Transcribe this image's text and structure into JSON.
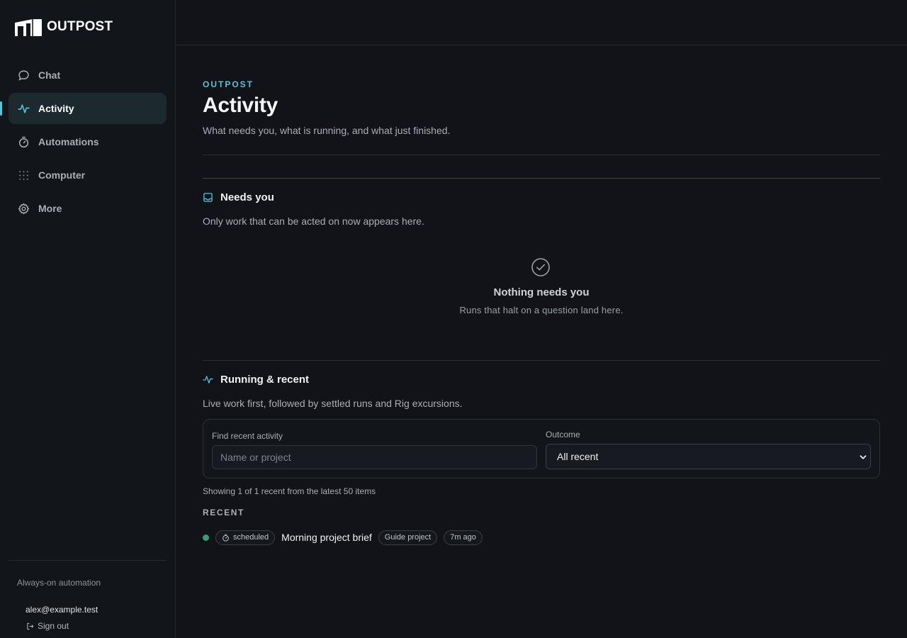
{
  "brand": {
    "name": "OUTPOST"
  },
  "sidebar": {
    "items": [
      {
        "label": "Chat",
        "icon": "chat-bubble-icon",
        "active": false
      },
      {
        "label": "Activity",
        "icon": "pulse-icon",
        "active": true
      },
      {
        "label": "Automations",
        "icon": "stopwatch-icon",
        "active": false
      },
      {
        "label": "Computer",
        "icon": "grid-dots-icon",
        "active": false
      },
      {
        "label": "More",
        "icon": "gear-icon",
        "active": false
      }
    ],
    "footer": {
      "label": "Always-on automation",
      "user": "alex@example.test",
      "sign_out": "Sign out"
    }
  },
  "page": {
    "eyebrow": "OUTPOST",
    "title": "Activity",
    "subtitle": "What needs you, what is running, and what just finished."
  },
  "needs_you": {
    "title": "Needs you",
    "description": "Only work that can be acted on now appears here.",
    "empty_title": "Nothing needs you",
    "empty_subtitle": "Runs that halt on a question land here."
  },
  "running": {
    "title": "Running & recent",
    "description": "Live work first, followed by settled runs and Rig excursions.",
    "search_label": "Find recent activity",
    "search_placeholder": "Name or project",
    "search_value": "",
    "outcome_label": "Outcome",
    "outcome_selected": "All recent",
    "showing": "Showing 1 of 1 recent from the latest 50 items",
    "recent_label": "RECENT",
    "rows": [
      {
        "status_color": "#3f9a74",
        "kind": "scheduled",
        "title": "Morning project brief",
        "project": "Guide project",
        "time": "7m ago"
      }
    ]
  },
  "colors": {
    "accent": "#5bc2d8",
    "background": "#111318",
    "success": "#3f9a74"
  }
}
